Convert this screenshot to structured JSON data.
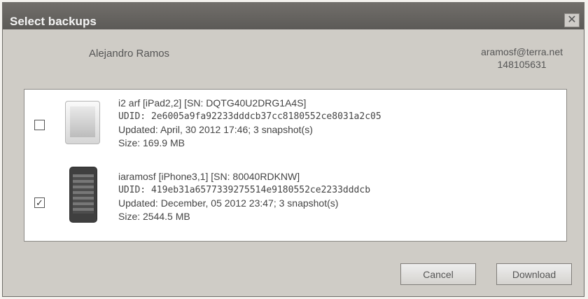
{
  "dialog": {
    "title": "Select backups",
    "close_glyph": "✕"
  },
  "account": {
    "name": "Alejandro Ramos",
    "email": "aramosf@terra.net",
    "id": "148105631"
  },
  "backups": [
    {
      "device_icon": "ipad-icon",
      "checked": false,
      "title": "i2 arf [iPad2,2] [SN: DQTG40U2DRG1A4S]",
      "udid": "UDID: 2e6005a9fa92233dddcb37cc8180552ce8031a2c05",
      "updated": "Updated: April, 30 2012 17:46; 3 snapshot(s)",
      "size": "Size: 169.9 MB"
    },
    {
      "device_icon": "iphone-icon",
      "checked": true,
      "check_glyph": "✓",
      "title": "iaramosf [iPhone3,1] [SN: 80040RDKNW]",
      "udid": "UDID: 419eb31a6577339275514e9180552ce2233dddcb",
      "updated": "Updated: December, 05 2012 23:47; 3 snapshot(s)",
      "size": "Size: 2544.5 MB"
    }
  ],
  "buttons": {
    "cancel": "Cancel",
    "download": "Download"
  }
}
